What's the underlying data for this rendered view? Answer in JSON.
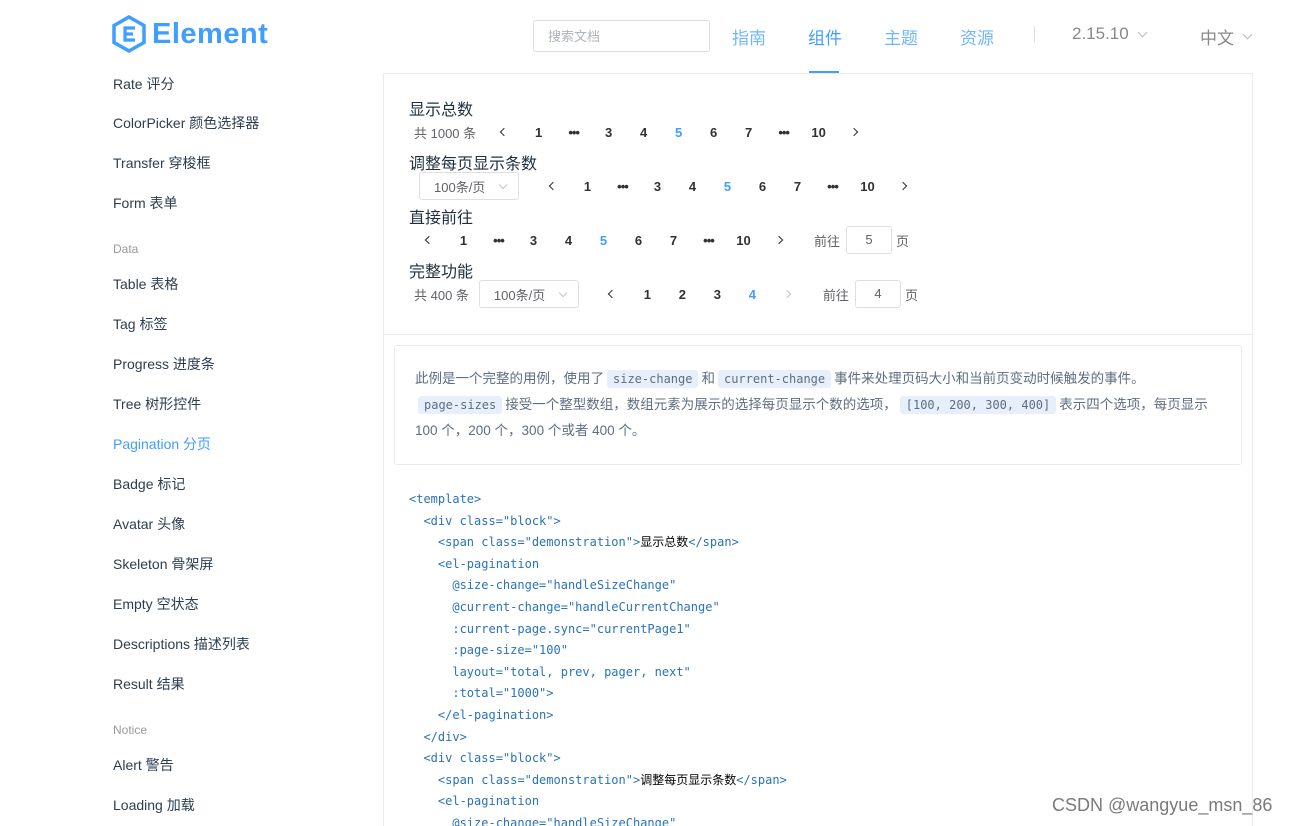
{
  "header": {
    "logo_text": "Element",
    "search_placeholder": "搜索文档",
    "nav": [
      {
        "label": "指南",
        "active": false
      },
      {
        "label": "组件",
        "active": true
      },
      {
        "label": "主题",
        "active": false
      },
      {
        "label": "资源",
        "active": false
      }
    ],
    "version": "2.15.10",
    "language": "中文"
  },
  "sidebar": {
    "items_top": [
      "Rate 评分",
      "ColorPicker 颜色选择器",
      "Transfer 穿梭框",
      "Form 表单"
    ],
    "group_data": "Data",
    "items_data": [
      "Table 表格",
      "Tag 标签",
      "Progress 进度条",
      "Tree 树形控件",
      "Pagination 分页",
      "Badge 标记",
      "Avatar 头像",
      "Skeleton 骨架屏",
      "Empty 空状态",
      "Descriptions 描述列表",
      "Result 结果"
    ],
    "group_notice": "Notice",
    "items_notice": [
      "Alert 警告",
      "Loading 加载"
    ],
    "active_item": "Pagination 分页"
  },
  "demo": {
    "sections": [
      {
        "title": "显示总数"
      },
      {
        "title": "调整每页显示条数"
      },
      {
        "title": "直接前往"
      },
      {
        "title": "完整功能"
      }
    ],
    "row1": {
      "total": "共 1000 条",
      "pages": [
        "1",
        "•••",
        "3",
        "4",
        "5",
        "6",
        "7",
        "•••",
        "10"
      ],
      "current": "5"
    },
    "row2": {
      "sizes": "100条/页",
      "pages": [
        "1",
        "•••",
        "3",
        "4",
        "5",
        "6",
        "7",
        "•••",
        "10"
      ],
      "current": "5"
    },
    "row3": {
      "pages": [
        "1",
        "•••",
        "3",
        "4",
        "5",
        "6",
        "7",
        "•••",
        "10"
      ],
      "current": "5",
      "goto_label": "前往",
      "goto_value": "5",
      "goto_suffix": "页"
    },
    "row4": {
      "total": "共 400 条",
      "sizes": "100条/页",
      "pages": [
        "1",
        "2",
        "3",
        "4"
      ],
      "current": "4",
      "goto_label": "前往",
      "goto_value": "4",
      "goto_suffix": "页"
    }
  },
  "description": {
    "p1": "此例是一个完整的用例，使用了",
    "c1": "size-change",
    "p2": "和",
    "c2": "current-change",
    "p3": "事件来处理页码大小和当前页变动时候触发的事件。",
    "c3": "page-sizes",
    "p4": "接受一个整型数组，数组元素为展示的选择每页显示个数的选项，",
    "c4": "[100, 200, 300, 400]",
    "p5": "表示四个选项，每页显示 100 个，200 个，300 个或者 400 个。"
  },
  "code_lines": [
    "<template>",
    "  <div class=\"block\">",
    "    <span class=\"demonstration\">显示总数</span>",
    "    <el-pagination",
    "      @size-change=\"handleSizeChange\"",
    "      @current-change=\"handleCurrentChange\"",
    "      :current-page.sync=\"currentPage1\"",
    "      :page-size=\"100\"",
    "      layout=\"total, prev, pager, next\"",
    "      :total=\"1000\">",
    "    </el-pagination>",
    "  </div>",
    "  <div class=\"block\">",
    "    <span class=\"demonstration\">调整每页显示条数</span>",
    "    <el-pagination",
    "      @size-change=\"handleSizeChange\""
  ],
  "watermark": "CSDN @wangyue_msn_86",
  "colors": {
    "accent": "#409eff",
    "text": "#303133",
    "muted": "#606266"
  }
}
